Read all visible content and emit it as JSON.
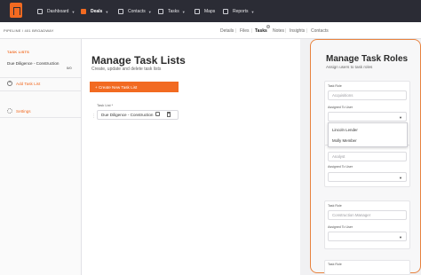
{
  "nav": {
    "items": [
      {
        "label": "Dashboard",
        "icon": "home-icon"
      },
      {
        "label": "Deals",
        "icon": "deals-icon"
      },
      {
        "label": "Contacts",
        "icon": "contacts-icon"
      },
      {
        "label": "Tasks",
        "icon": "tasks-icon"
      },
      {
        "label": "Maps",
        "icon": "maps-icon"
      },
      {
        "label": "Reports",
        "icon": "reports-icon"
      }
    ],
    "active": "Deals",
    "accent_color": "#f26a21"
  },
  "breadcrumb": "PIPELINE / 401 BROADWAY",
  "tabs": [
    "Details",
    "Files",
    "Tasks",
    "Notes",
    "Insights",
    "Contacts"
  ],
  "active_tab": "Tasks",
  "sidebar": {
    "heading": "TASK LISTS",
    "list_item": "Due Diligence - Construction",
    "list_count": "0/0",
    "add_label": "Add Task List",
    "settings_label": "Settings"
  },
  "main": {
    "title": "Manage Task Lists",
    "subtitle": "Create, update and delete task lists",
    "create_button": "+ Create New Task List",
    "field_label": "Task List *",
    "task_list_value": "Due Diligence - Construction"
  },
  "roles": {
    "title": "Manage Task Roles",
    "subtitle": "Assign users to task roles",
    "task_role_label": "Task Role",
    "assigned_label": "Assigned To User",
    "role_1": "Acquisitions",
    "role_2": "Analyst",
    "role_3": "Construction Manager",
    "dropdown_options": [
      "Lincoln Lender",
      "Molly Member"
    ]
  }
}
